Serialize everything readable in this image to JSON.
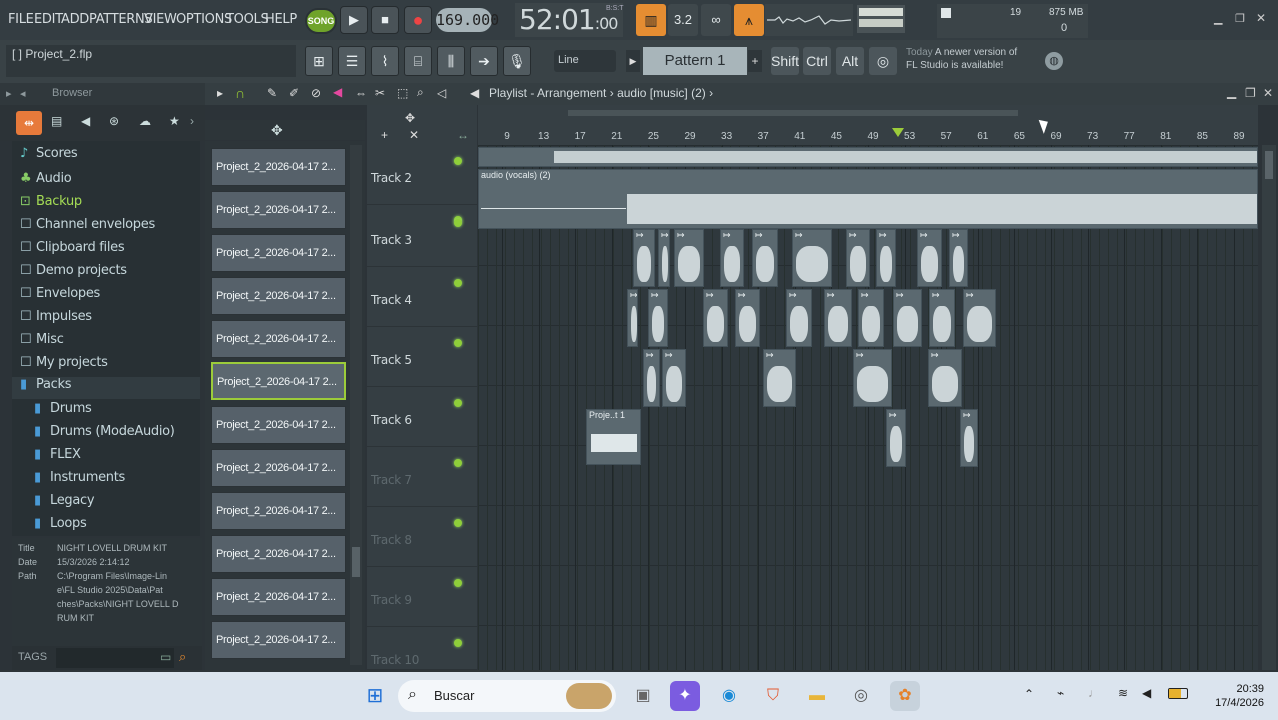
{
  "menu": [
    "FILE",
    "EDIT",
    "ADD",
    "PATTERNS",
    "VIEW",
    "OPTIONS",
    "TOOLS",
    "HELP"
  ],
  "transport": {
    "song_label": "SONG",
    "tempo": "169.000",
    "time": "52:01",
    "time_sub": ":00",
    "time_unit": "B:S:T"
  },
  "cpu": {
    "voices": "19",
    "memory": "875 MB",
    "poly": "0"
  },
  "project": {
    "name": "[   ] Project_2.flp"
  },
  "toolbar2": {
    "snap": "Line",
    "pattern": "Pattern 1",
    "shift": "Shift",
    "ctrl": "Ctrl",
    "alt": "Alt"
  },
  "hint": {
    "today": "Today",
    "text1": "A newer version of",
    "text2": "FL Studio is available!"
  },
  "browser": {
    "title": "Browser",
    "items": [
      {
        "label": "Scores",
        "icon": "♪"
      },
      {
        "label": "Audio",
        "icon": "♣"
      },
      {
        "label": "Backup",
        "icon": "⊡"
      },
      {
        "label": "Channel envelopes",
        "icon": "☐"
      },
      {
        "label": "Clipboard files",
        "icon": "☐"
      },
      {
        "label": "Demo projects",
        "icon": "☐"
      },
      {
        "label": "Envelopes",
        "icon": "☐"
      },
      {
        "label": "Impulses",
        "icon": "☐"
      },
      {
        "label": "Misc",
        "icon": "☐"
      },
      {
        "label": "My projects",
        "icon": "☐"
      },
      {
        "label": "Packs",
        "icon": "▮"
      },
      {
        "label": "Drums",
        "icon": "▮"
      },
      {
        "label": "Drums (ModeAudio)",
        "icon": "▮"
      },
      {
        "label": "FLEX",
        "icon": "▮"
      },
      {
        "label": "Instruments",
        "icon": "▮"
      },
      {
        "label": "Legacy",
        "icon": "▮"
      },
      {
        "label": "Loops",
        "icon": "▮"
      }
    ],
    "info": {
      "title_k": "Title",
      "title_v": "NIGHT LOVELL DRUM KIT",
      "date_k": "Date",
      "date_v": "15/3/2026 2:14:12",
      "path_k": "Path",
      "path_v1": "C:\\Program Files\\Image-Lin",
      "path_v2": "e\\FL Studio 2025\\Data\\Pat",
      "path_v3": "ches\\Packs\\NIGHT LOVELL D",
      "path_v4": "RUM KIT"
    },
    "tags": "TAGS"
  },
  "picker": {
    "items": [
      "Project_2_2026-04-17 2...",
      "Project_2_2026-04-17 2...",
      "Project_2_2026-04-17 2...",
      "Project_2_2026-04-17 2...",
      "Project_2_2026-04-17 2...",
      "Project_2_2026-04-17 2...",
      "Project_2_2026-04-17 2...",
      "Project_2_2026-04-17 2...",
      "Project_2_2026-04-17 2...",
      "Project_2_2026-04-17 2...",
      "Project_2_2026-04-17 2...",
      "Project_2_2026-04-17 2..."
    ],
    "selected": 5
  },
  "playlist": {
    "title": "Playlist - Arrangement",
    "breadcrumb": "audio [music] (2)",
    "ruler": [
      "9",
      "13",
      "17",
      "21",
      "25",
      "29",
      "33",
      "37",
      "41",
      "45",
      "49",
      "53",
      "57",
      "61",
      "65",
      "69",
      "73",
      "77",
      "81",
      "85",
      "89"
    ],
    "tracks": [
      "",
      "Track 2",
      "Track 3",
      "Track 4",
      "Track 5",
      "Track 6",
      "Track 7",
      "Track 8",
      "Track 9",
      "Track 10"
    ],
    "clips": {
      "vocals": "audio (vocals) (2)",
      "t3_pro": "Pro...",
      "t6": "Proje..t 1",
      "t5_a": "Pr",
      "t5_b": "Pr"
    }
  },
  "taskbar": {
    "search": "Buscar",
    "time": "20:39",
    "date": "17/4/2026"
  }
}
